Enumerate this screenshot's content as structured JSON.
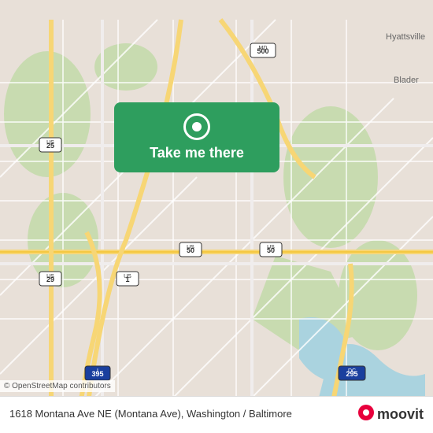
{
  "map": {
    "backgroundColor": "#e8e0d8",
    "center": {
      "lat": 38.93,
      "lng": -76.99
    },
    "city": "Washington DC / Baltimore area"
  },
  "button": {
    "label": "Take me there",
    "backgroundColor": "#2e9e5e",
    "pinColor": "#ffffff"
  },
  "attribution": {
    "text": "© OpenStreetMap contributors"
  },
  "infoBar": {
    "address": "1618 Montana Ave NE (Montana Ave), Washington / Baltimore",
    "logoText": "moovit"
  },
  "roads": {
    "highways": [
      "US 29",
      "US 1",
      "US 50",
      "MD 500",
      "DC 295",
      "I-395"
    ],
    "colors": {
      "highway": "#f7d675",
      "major": "#f5c842",
      "minor": "#ffffff",
      "background": "#e8e0d8",
      "green": "#c8dbb0",
      "water": "#aad3df"
    }
  }
}
